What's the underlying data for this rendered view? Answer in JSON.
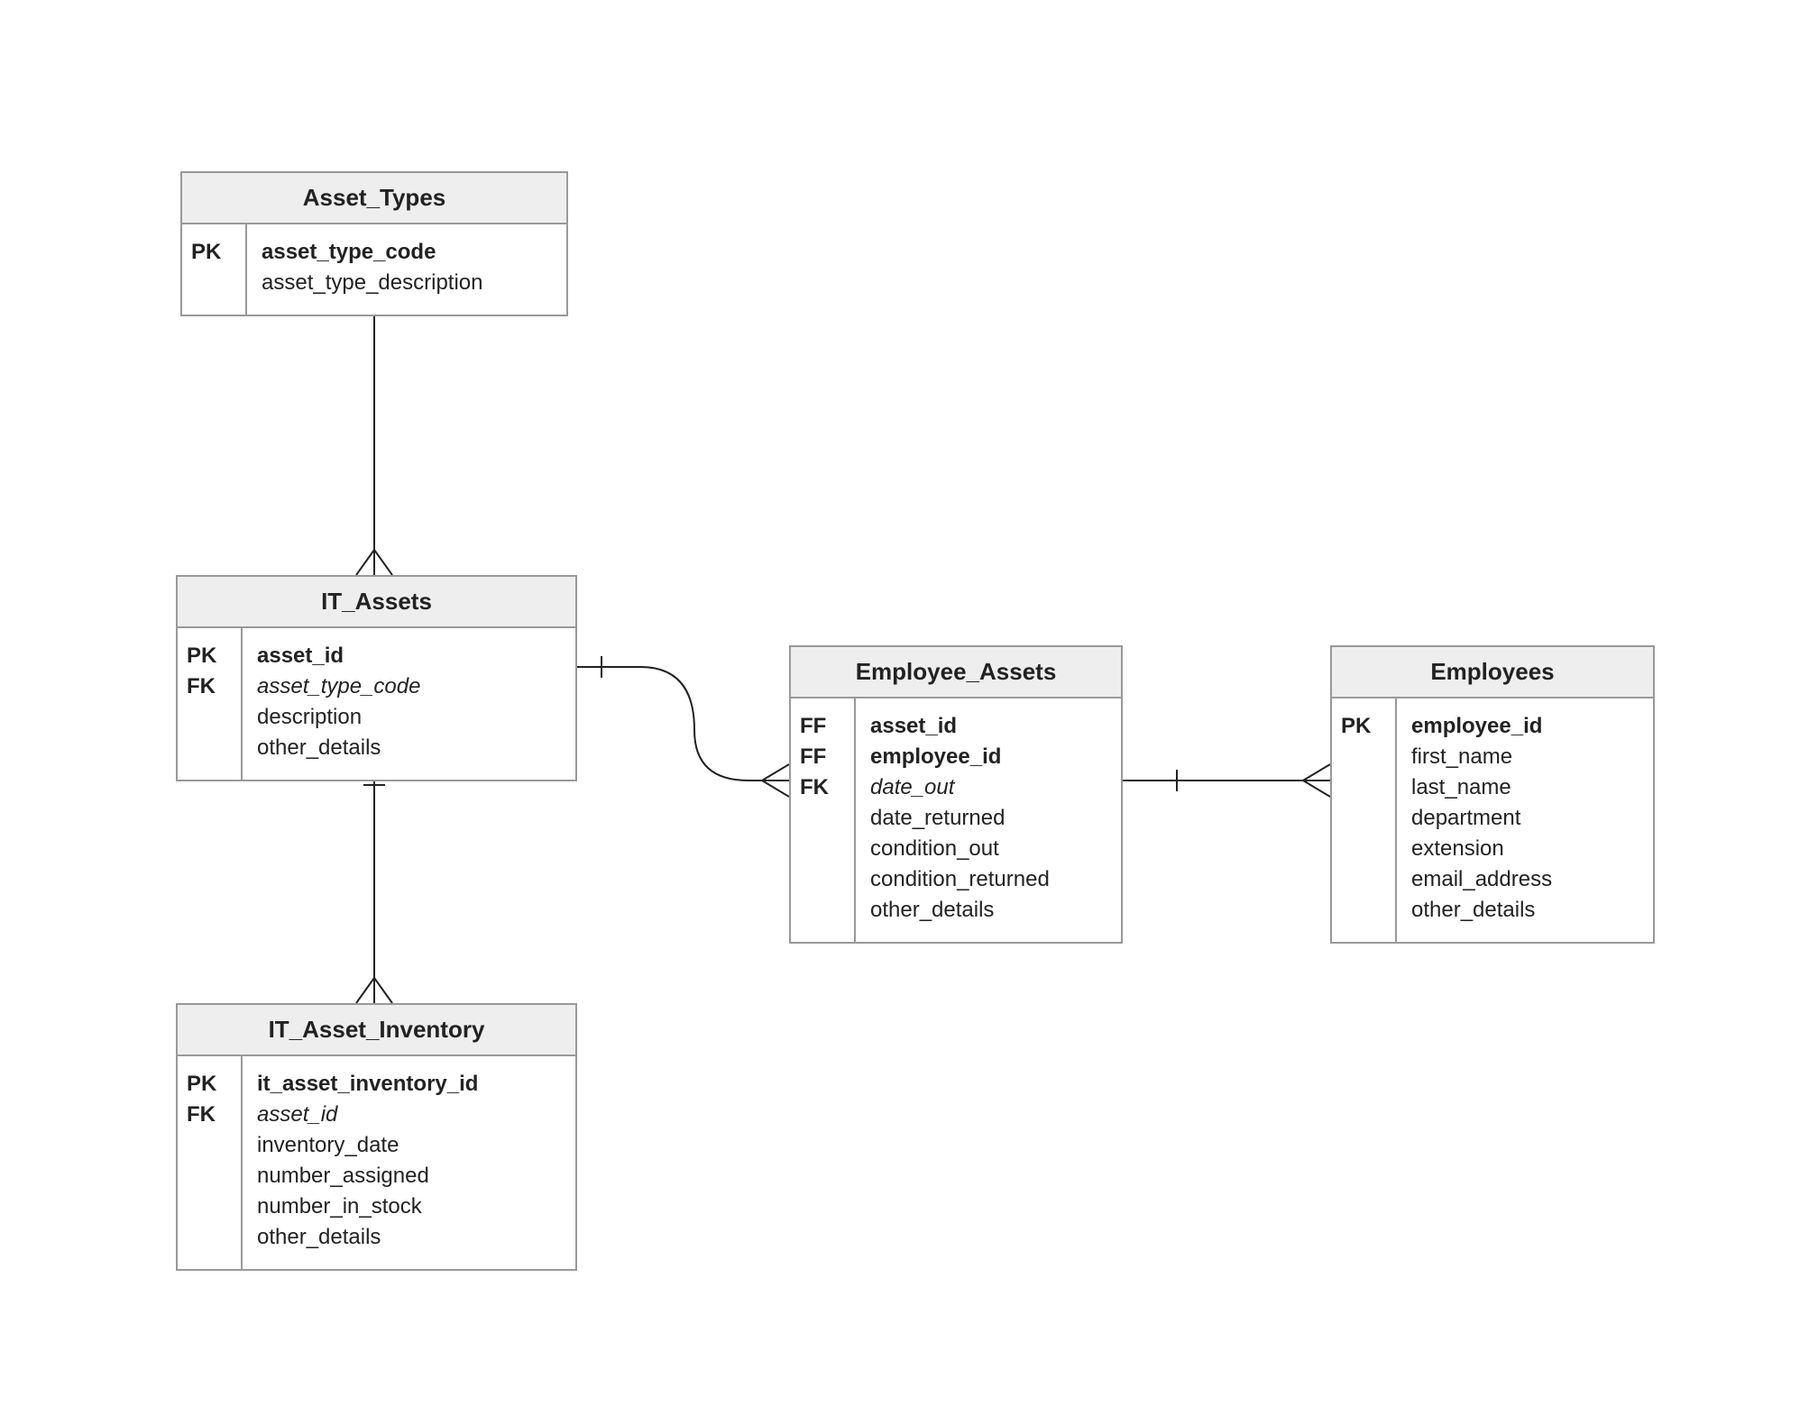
{
  "diagram_type": "Entity-Relationship Diagram",
  "entities": {
    "asset_types": {
      "title": "Asset_Types",
      "keys": [
        "PK",
        ""
      ],
      "fields": [
        {
          "name": "asset_type_code",
          "style": "bold"
        },
        {
          "name": "asset_type_description",
          "style": "normal"
        }
      ]
    },
    "it_assets": {
      "title": "IT_Assets",
      "keys": [
        "PK",
        "FK",
        "",
        ""
      ],
      "fields": [
        {
          "name": "asset_id",
          "style": "bold"
        },
        {
          "name": "asset_type_code",
          "style": "italic"
        },
        {
          "name": "description",
          "style": "normal"
        },
        {
          "name": "other_details",
          "style": "normal"
        }
      ]
    },
    "it_asset_inventory": {
      "title": "IT_Asset_Inventory",
      "keys": [
        "PK",
        "FK",
        "",
        "",
        "",
        ""
      ],
      "fields": [
        {
          "name": "it_asset_inventory_id",
          "style": "bold"
        },
        {
          "name": "asset_id",
          "style": "italic"
        },
        {
          "name": "inventory_date",
          "style": "normal"
        },
        {
          "name": "number_assigned",
          "style": "normal"
        },
        {
          "name": "number_in_stock",
          "style": "normal"
        },
        {
          "name": "other_details",
          "style": "normal"
        }
      ]
    },
    "employee_assets": {
      "title": "Employee_Assets",
      "keys": [
        "FF",
        "FF",
        "FK",
        "",
        "",
        "",
        ""
      ],
      "fields": [
        {
          "name": "asset_id",
          "style": "bold"
        },
        {
          "name": "employee_id",
          "style": "bold"
        },
        {
          "name": "date_out",
          "style": "italic"
        },
        {
          "name": "date_returned",
          "style": "normal"
        },
        {
          "name": "condition_out",
          "style": "normal"
        },
        {
          "name": "condition_returned",
          "style": "normal"
        },
        {
          "name": "other_details",
          "style": "normal"
        }
      ]
    },
    "employees": {
      "title": "Employees",
      "keys": [
        "PK",
        "",
        "",
        "",
        "",
        "",
        ""
      ],
      "fields": [
        {
          "name": "employee_id",
          "style": "bold"
        },
        {
          "name": "first_name",
          "style": "normal"
        },
        {
          "name": "last_name",
          "style": "normal"
        },
        {
          "name": "department",
          "style": "normal"
        },
        {
          "name": "extension",
          "style": "normal"
        },
        {
          "name": "email_address",
          "style": "normal"
        },
        {
          "name": "other_details",
          "style": "normal"
        }
      ]
    }
  },
  "relationships": [
    {
      "from": "asset_types",
      "to": "it_assets",
      "type": "one-to-many"
    },
    {
      "from": "it_assets",
      "to": "it_asset_inventory",
      "type": "one-to-many"
    },
    {
      "from": "it_assets",
      "to": "employee_assets",
      "type": "one-to-many"
    },
    {
      "from": "employees",
      "to": "employee_assets",
      "type": "one-to-many"
    }
  ]
}
